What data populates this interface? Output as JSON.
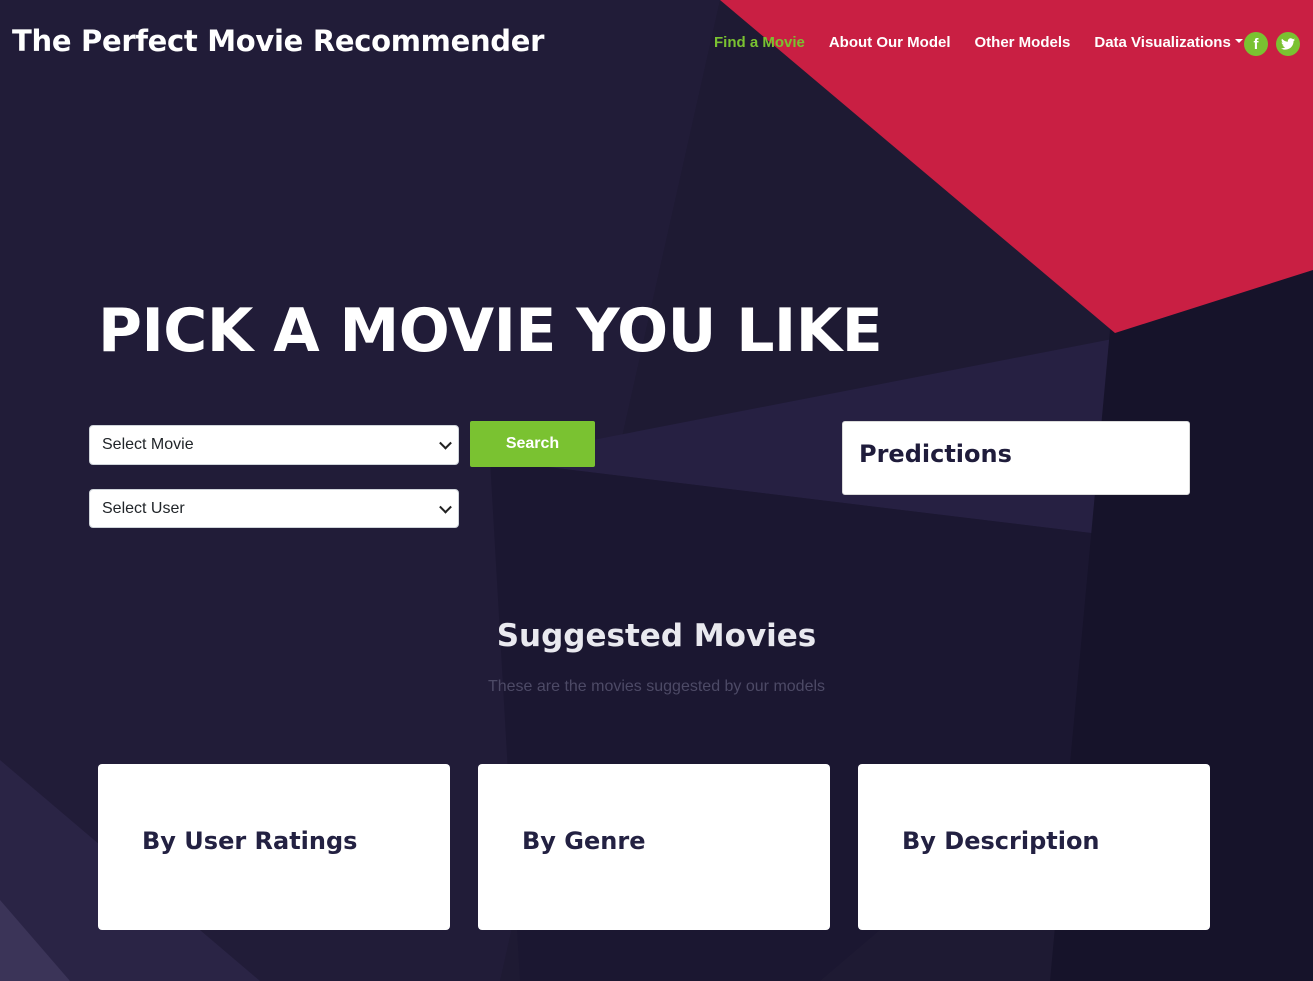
{
  "header": {
    "brand": "The Perfect Movie Recommender",
    "nav": [
      {
        "label": "Find a Movie",
        "active": true
      },
      {
        "label": "About Our Model",
        "active": false
      },
      {
        "label": "Other Models",
        "active": false
      },
      {
        "label": "Data Visualizations",
        "active": false,
        "dropdown": true
      }
    ],
    "social": [
      {
        "icon": "facebook-icon",
        "glyph": "f"
      },
      {
        "icon": "twitter-icon",
        "glyph": "t"
      }
    ]
  },
  "hero": {
    "title": "PICK A MOVIE YOU LIKE"
  },
  "form": {
    "movie_select": "Select Movie",
    "user_select": "Select User",
    "search_label": "Search"
  },
  "predictions": {
    "title": "Predictions"
  },
  "suggested": {
    "title": "Suggested Movies",
    "subtitle": "These are the movies suggested by our models",
    "cards": [
      {
        "title": "By User Ratings"
      },
      {
        "title": "By Genre"
      },
      {
        "title": "By Description"
      }
    ]
  },
  "colors": {
    "background": "#1e1a33",
    "accent": "#7ac231",
    "red_shape": "#c91f43"
  }
}
